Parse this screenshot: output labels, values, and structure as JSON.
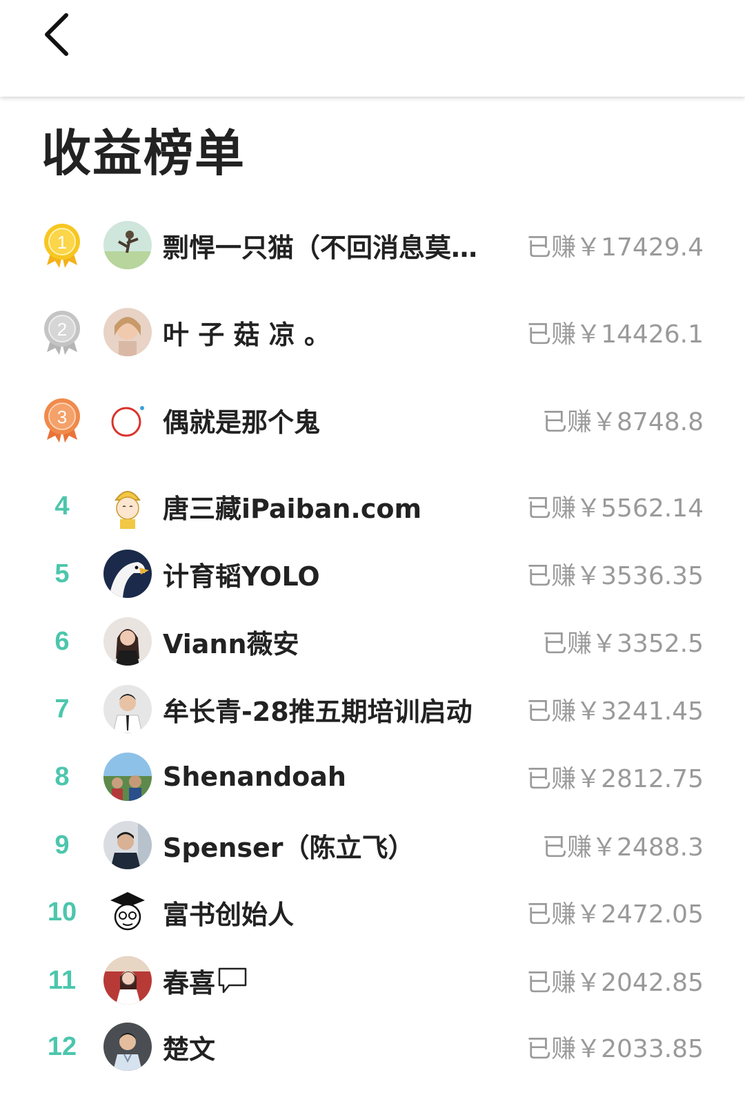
{
  "header": {
    "back_icon": "chevron-left-icon"
  },
  "title": "收益榜单",
  "colors": {
    "rank_accent": "#4cc6ac",
    "earn_text": "#9a9a9a",
    "gold": "#f7c623",
    "silver": "#c4c4c4",
    "bronze": "#f08a4b"
  },
  "leaderboard": [
    {
      "rank": "1",
      "medal": "gold",
      "name": "剽悍一只猫（不回消息莫…",
      "earned": "已赚￥17429.4"
    },
    {
      "rank": "2",
      "medal": "silver",
      "name": "叶 子 菇 凉 。",
      "earned": "已赚￥14426.1"
    },
    {
      "rank": "3",
      "medal": "bronze",
      "name": "偶就是那个鬼",
      "earned": "已赚￥8748.8"
    },
    {
      "rank": "4",
      "name": "唐三藏iPaiban.com",
      "earned": "已赚￥5562.14"
    },
    {
      "rank": "5",
      "name": "计育韬YOLO",
      "earned": "已赚￥3536.35"
    },
    {
      "rank": "6",
      "name": "Viann薇安",
      "earned": "已赚￥3352.5"
    },
    {
      "rank": "7",
      "name": "牟长青-28推五期培训启动",
      "earned": "已赚￥3241.45"
    },
    {
      "rank": "8",
      "name": "Shenandoah",
      "earned": "已赚￥2812.75"
    },
    {
      "rank": "9",
      "name": "Spenser（陈立飞）",
      "earned": "已赚￥2488.3"
    },
    {
      "rank": "10",
      "name": "富书创始人",
      "earned": "已赚￥2472.05"
    },
    {
      "rank": "11",
      "name": "春喜",
      "earned": "已赚￥2042.85"
    },
    {
      "rank": "12",
      "name": "楚文",
      "earned": "已赚￥2033.85"
    }
  ]
}
